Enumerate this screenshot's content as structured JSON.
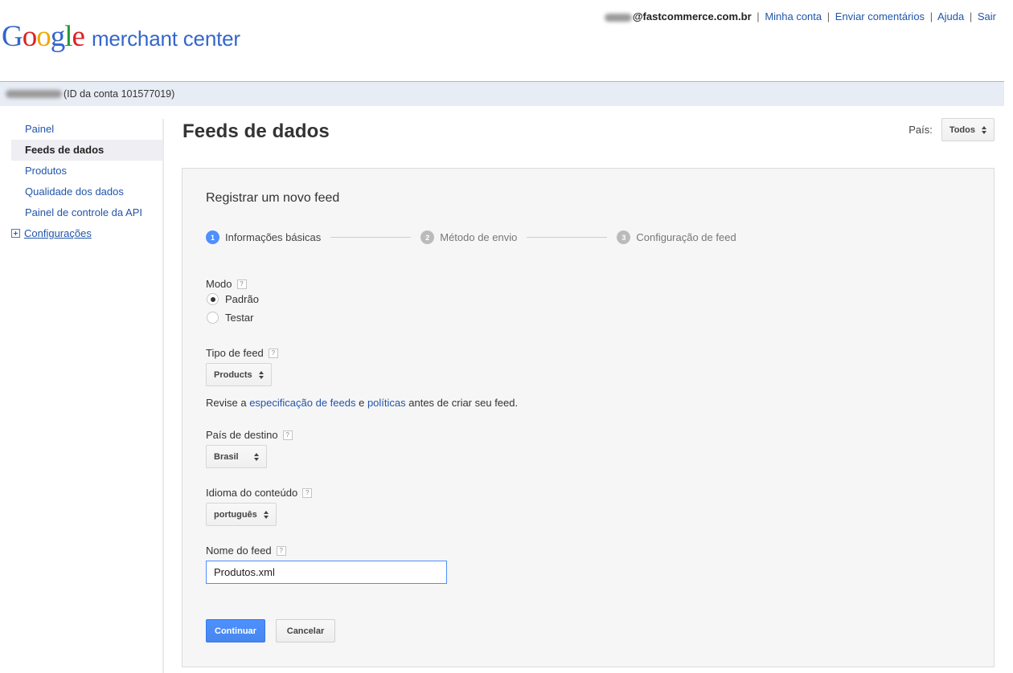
{
  "header": {
    "logo": {
      "brand": [
        "G",
        "o",
        "o",
        "g",
        "l",
        "e"
      ],
      "product": "merchant center"
    },
    "user_email": "@fastcommerce.com.br",
    "links": {
      "my_account": "Minha conta",
      "feedback": "Enviar comentários",
      "help": "Ajuda",
      "sign_out": "Sair"
    },
    "separator": "|"
  },
  "account": {
    "id_text": "(ID da conta 101577019)"
  },
  "sidebar": {
    "items": [
      {
        "label": "Painel"
      },
      {
        "label": "Feeds de dados",
        "active": true
      },
      {
        "label": "Produtos"
      },
      {
        "label": "Qualidade dos dados"
      },
      {
        "label": "Painel de controle da API"
      },
      {
        "label": "Configurações",
        "expandable": true
      }
    ]
  },
  "main": {
    "title": "Feeds de dados",
    "country_filter": {
      "label": "País:",
      "value": "Todos"
    },
    "form": {
      "title": "Registrar um novo feed",
      "steps": [
        {
          "num": "1",
          "label": "Informações básicas",
          "current": true
        },
        {
          "num": "2",
          "label": "Método de envio"
        },
        {
          "num": "3",
          "label": "Configuração de feed"
        }
      ],
      "mode": {
        "label": "Modo",
        "help": "?",
        "options": [
          "Padrão",
          "Testar"
        ],
        "selected": "Padrão"
      },
      "feed_type": {
        "label": "Tipo de feed",
        "help": "?",
        "value": "Products"
      },
      "hint": {
        "prefix": "Revise a ",
        "link1": "especificação de feeds",
        "middle": " e ",
        "link2": "políticas",
        "suffix": " antes de criar seu feed."
      },
      "target_country": {
        "label": "País de destino",
        "help": "?",
        "value": "Brasil"
      },
      "content_language": {
        "label": "Idioma do conteúdo",
        "help": "?",
        "value": "português"
      },
      "feed_name": {
        "label": "Nome do feed",
        "help": "?",
        "value": "Produtos.xml"
      },
      "buttons": {
        "continue": "Continuar",
        "cancel": "Cancelar"
      }
    }
  },
  "colors": {
    "accent": "#4d90fe",
    "link": "#2255aa",
    "account_bar": "#e8ecf5"
  }
}
